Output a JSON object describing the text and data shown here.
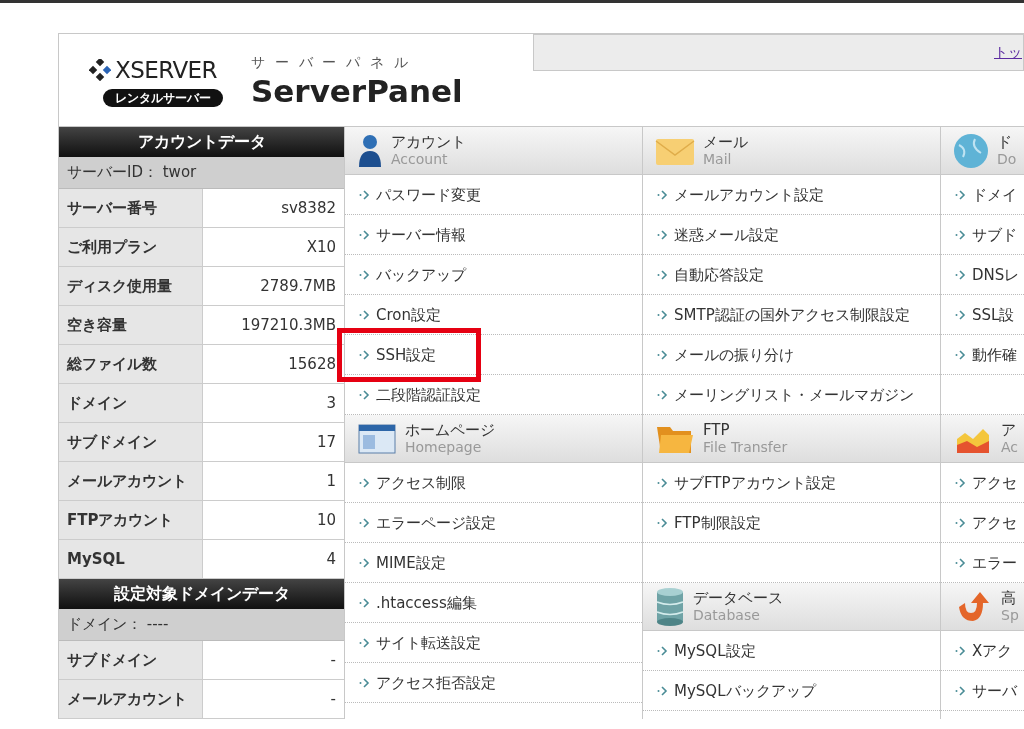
{
  "header": {
    "logo_text": "XSERVER",
    "logo_badge": "レンタルサーバー",
    "panel_kana": "サーバーパネル",
    "panel_title": "ServerPanel",
    "top_link": "トッ"
  },
  "account_data": {
    "title": "アカウントデータ",
    "summary": "サーバーID： twor",
    "rows": [
      {
        "label": "サーバー番号",
        "value": "sv8382"
      },
      {
        "label": "ご利用プラン",
        "value": "X10"
      },
      {
        "label": "ディスク使用量",
        "value": "2789.7MB"
      },
      {
        "label": "空き容量",
        "value": "197210.3MB"
      },
      {
        "label": "総ファイル数",
        "value": "15628"
      },
      {
        "label": "ドメイン",
        "value": "3"
      },
      {
        "label": "サブドメイン",
        "value": "17"
      },
      {
        "label": "メールアカウント",
        "value": "1"
      },
      {
        "label": "FTPアカウント",
        "value": "10"
      },
      {
        "label": "MySQL",
        "value": "4"
      }
    ]
  },
  "domain_data": {
    "title": "設定対象ドメインデータ",
    "summary": "ドメイン： ----",
    "rows": [
      {
        "label": "サブドメイン",
        "value": "-"
      },
      {
        "label": "メールアカウント",
        "value": "-"
      }
    ]
  },
  "menu_columns": [
    [
      {
        "kind": "person",
        "title": "アカウント",
        "subtitle": "Account",
        "items": [
          {
            "label": "パスワード変更",
            "highlighted": false
          },
          {
            "label": "サーバー情報",
            "highlighted": false
          },
          {
            "label": "バックアップ",
            "highlighted": false
          },
          {
            "label": "Cron設定",
            "highlighted": false
          },
          {
            "label": "SSH設定",
            "highlighted": true
          },
          {
            "label": "二段階認証設定",
            "highlighted": false
          }
        ]
      },
      {
        "kind": "window",
        "title": "ホームページ",
        "subtitle": "Homepage",
        "items": [
          {
            "label": "アクセス制限",
            "highlighted": false
          },
          {
            "label": "エラーページ設定",
            "highlighted": false
          },
          {
            "label": "MIME設定",
            "highlighted": false
          },
          {
            "label": ".htaccess編集",
            "highlighted": false
          },
          {
            "label": "サイト転送設定",
            "highlighted": false
          },
          {
            "label": "アクセス拒否設定",
            "highlighted": false
          }
        ]
      }
    ],
    [
      {
        "kind": "envelope",
        "title": "メール",
        "subtitle": "Mail",
        "items": [
          {
            "label": "メールアカウント設定",
            "highlighted": false
          },
          {
            "label": "迷惑メール設定",
            "highlighted": false
          },
          {
            "label": "自動応答設定",
            "highlighted": false
          },
          {
            "label": "SMTP認証の国外アクセス制限設定",
            "highlighted": false
          },
          {
            "label": "メールの振り分け",
            "highlighted": false
          },
          {
            "label": "メーリングリスト・メールマガジン",
            "highlighted": false
          }
        ]
      },
      {
        "kind": "folder",
        "title": "FTP",
        "subtitle": "File Transfer",
        "items": [
          {
            "label": "サブFTPアカウント設定",
            "highlighted": false
          },
          {
            "label": "FTP制限設定",
            "highlighted": false
          }
        ]
      },
      {
        "kind": "database",
        "title": "データベース",
        "subtitle": "Database",
        "items": [
          {
            "label": "MySQL設定",
            "highlighted": false
          },
          {
            "label": "MySQLバックアップ",
            "highlighted": false
          }
        ]
      }
    ],
    [
      {
        "kind": "globe",
        "title": "ド",
        "subtitle": "Do",
        "items": [
          {
            "label": "ドメイ",
            "highlighted": false
          },
          {
            "label": "サブド",
            "highlighted": false
          },
          {
            "label": "DNSレ",
            "highlighted": false
          },
          {
            "label": "SSL設",
            "highlighted": false
          },
          {
            "label": "動作確",
            "highlighted": false
          }
        ]
      },
      {
        "kind": "chart",
        "title": "ア",
        "subtitle": "Ac",
        "items": [
          {
            "label": "アクセ",
            "highlighted": false
          },
          {
            "label": "アクセ",
            "highlighted": false
          },
          {
            "label": "エラー",
            "highlighted": false
          }
        ]
      },
      {
        "kind": "arrow",
        "title": "高",
        "subtitle": "Sp",
        "items": [
          {
            "label": "Xアク",
            "highlighted": false
          },
          {
            "label": "サーバ",
            "highlighted": false
          }
        ]
      }
    ]
  ]
}
